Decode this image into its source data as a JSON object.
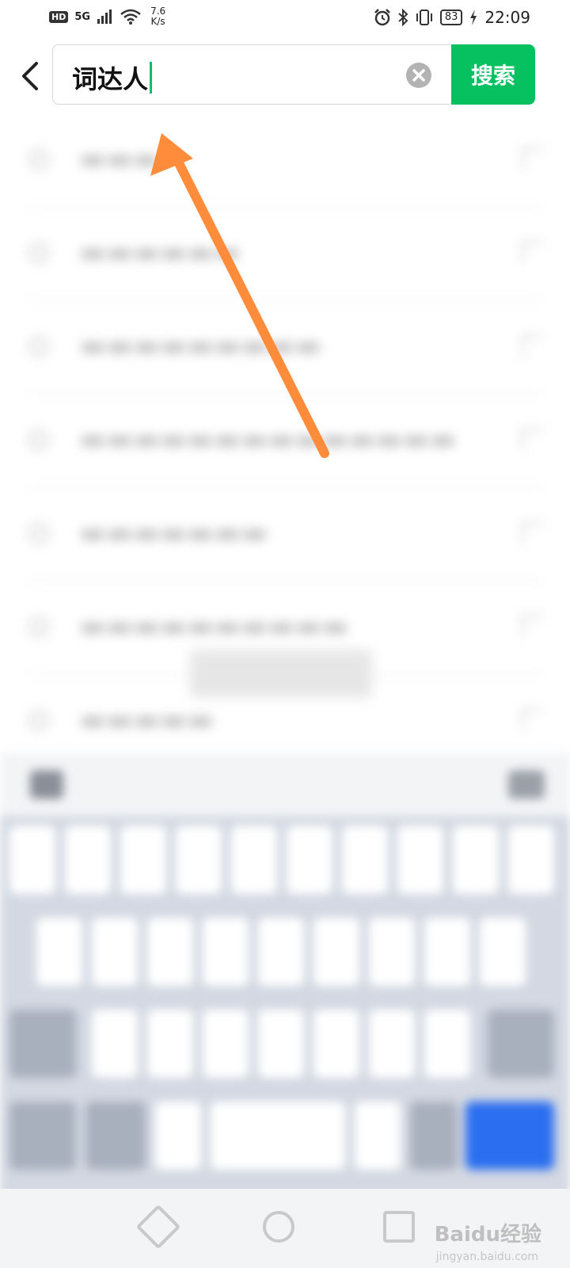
{
  "status_bar": {
    "hd": "HD",
    "signal": "5G",
    "net_speed_value": "7.6",
    "net_speed_unit": "K/s",
    "battery": "83",
    "time": "22:09"
  },
  "search": {
    "value": "词达人",
    "button_label": "搜索"
  },
  "colors": {
    "accent": "#07c160",
    "arrow": "#ff8c3a",
    "keyboard_action": "#2b6ff0"
  },
  "watermark": {
    "brand": "Baidu经验",
    "url": "jingyan.baidu.com"
  }
}
